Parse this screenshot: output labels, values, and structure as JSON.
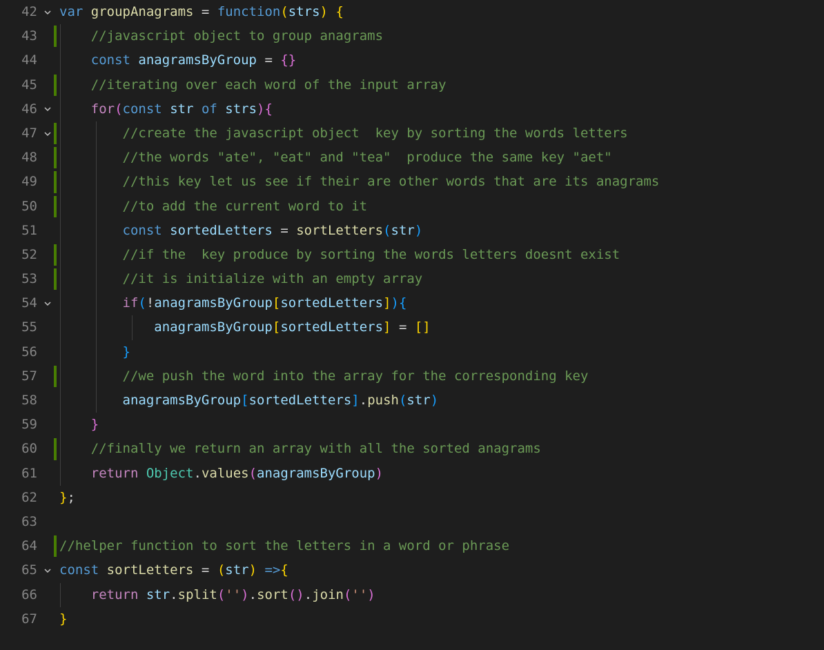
{
  "lines": [
    {
      "num": "42",
      "fold": "v",
      "mod": false,
      "guides": [],
      "tokens": [
        {
          "t": "var ",
          "c": "tok-kw"
        },
        {
          "t": "groupAnagrams",
          "c": "tok-fn"
        },
        {
          "t": " = ",
          "c": "tok-op"
        },
        {
          "t": "function",
          "c": "tok-kw"
        },
        {
          "t": "(",
          "c": "tok-br1"
        },
        {
          "t": "strs",
          "c": "tok-var"
        },
        {
          "t": ") ",
          "c": "tok-br1"
        },
        {
          "t": "{",
          "c": "tok-br1"
        }
      ]
    },
    {
      "num": "43",
      "fold": "",
      "mod": true,
      "guides": [
        0
      ],
      "tokens": [
        {
          "t": "    ",
          "c": ""
        },
        {
          "t": "//javascript object to group anagrams",
          "c": "tok-cmt"
        }
      ]
    },
    {
      "num": "44",
      "fold": "",
      "mod": false,
      "guides": [
        0
      ],
      "tokens": [
        {
          "t": "    ",
          "c": ""
        },
        {
          "t": "const ",
          "c": "tok-kw"
        },
        {
          "t": "anagramsByGroup",
          "c": "tok-var"
        },
        {
          "t": " = ",
          "c": "tok-op"
        },
        {
          "t": "{}",
          "c": "tok-br2"
        }
      ]
    },
    {
      "num": "45",
      "fold": "",
      "mod": true,
      "guides": [
        0
      ],
      "tokens": [
        {
          "t": "    ",
          "c": ""
        },
        {
          "t": "//iterating over each word of the input array",
          "c": "tok-cmt"
        }
      ]
    },
    {
      "num": "46",
      "fold": "v",
      "mod": false,
      "guides": [
        0
      ],
      "tokens": [
        {
          "t": "    ",
          "c": ""
        },
        {
          "t": "for",
          "c": "tok-kw2"
        },
        {
          "t": "(",
          "c": "tok-br2"
        },
        {
          "t": "const ",
          "c": "tok-kw"
        },
        {
          "t": "str",
          "c": "tok-var"
        },
        {
          "t": " of ",
          "c": "tok-kw"
        },
        {
          "t": "strs",
          "c": "tok-var"
        },
        {
          "t": ")",
          "c": "tok-br2"
        },
        {
          "t": "{",
          "c": "tok-br2"
        }
      ]
    },
    {
      "num": "47",
      "fold": "v",
      "mod": true,
      "guides": [
        0,
        1
      ],
      "tokens": [
        {
          "t": "        ",
          "c": ""
        },
        {
          "t": "//create the javascript object  key by sorting the words letters",
          "c": "tok-cmt"
        }
      ]
    },
    {
      "num": "48",
      "fold": "",
      "mod": true,
      "guides": [
        0,
        1
      ],
      "tokens": [
        {
          "t": "        ",
          "c": ""
        },
        {
          "t": "//the words \"ate\", \"eat\" and \"tea\"  produce the same key \"aet\"",
          "c": "tok-cmt"
        }
      ]
    },
    {
      "num": "49",
      "fold": "",
      "mod": true,
      "guides": [
        0,
        1
      ],
      "tokens": [
        {
          "t": "        ",
          "c": ""
        },
        {
          "t": "//this key let us see if their are other words that are its anagrams",
          "c": "tok-cmt"
        }
      ]
    },
    {
      "num": "50",
      "fold": "",
      "mod": true,
      "guides": [
        0,
        1
      ],
      "tokens": [
        {
          "t": "        ",
          "c": ""
        },
        {
          "t": "//to add the current word to it",
          "c": "tok-cmt"
        }
      ]
    },
    {
      "num": "51",
      "fold": "",
      "mod": false,
      "guides": [
        0,
        1
      ],
      "tokens": [
        {
          "t": "        ",
          "c": ""
        },
        {
          "t": "const ",
          "c": "tok-kw"
        },
        {
          "t": "sortedLetters",
          "c": "tok-var"
        },
        {
          "t": " = ",
          "c": "tok-op"
        },
        {
          "t": "sortLetters",
          "c": "tok-fn"
        },
        {
          "t": "(",
          "c": "tok-br3"
        },
        {
          "t": "str",
          "c": "tok-var"
        },
        {
          "t": ")",
          "c": "tok-br3"
        }
      ]
    },
    {
      "num": "52",
      "fold": "",
      "mod": true,
      "guides": [
        0,
        1
      ],
      "tokens": [
        {
          "t": "        ",
          "c": ""
        },
        {
          "t": "//if the  key produce by sorting the words letters doesnt exist",
          "c": "tok-cmt"
        }
      ]
    },
    {
      "num": "53",
      "fold": "",
      "mod": true,
      "guides": [
        0,
        1
      ],
      "tokens": [
        {
          "t": "        ",
          "c": ""
        },
        {
          "t": "//it is initialize with an empty array",
          "c": "tok-cmt"
        }
      ]
    },
    {
      "num": "54",
      "fold": "v",
      "mod": false,
      "guides": [
        0,
        1
      ],
      "tokens": [
        {
          "t": "        ",
          "c": ""
        },
        {
          "t": "if",
          "c": "tok-kw2"
        },
        {
          "t": "(",
          "c": "tok-br3"
        },
        {
          "t": "!",
          "c": "tok-op"
        },
        {
          "t": "anagramsByGroup",
          "c": "tok-var"
        },
        {
          "t": "[",
          "c": "tok-br1"
        },
        {
          "t": "sortedLetters",
          "c": "tok-var"
        },
        {
          "t": "]",
          "c": "tok-br1"
        },
        {
          "t": ")",
          "c": "tok-br3"
        },
        {
          "t": "{",
          "c": "tok-br3"
        }
      ]
    },
    {
      "num": "55",
      "fold": "",
      "mod": false,
      "guides": [
        0,
        1,
        2
      ],
      "tokens": [
        {
          "t": "            ",
          "c": ""
        },
        {
          "t": "anagramsByGroup",
          "c": "tok-var"
        },
        {
          "t": "[",
          "c": "tok-br1"
        },
        {
          "t": "sortedLetters",
          "c": "tok-var"
        },
        {
          "t": "]",
          "c": "tok-br1"
        },
        {
          "t": " = ",
          "c": "tok-op"
        },
        {
          "t": "[]",
          "c": "tok-br1"
        }
      ]
    },
    {
      "num": "56",
      "fold": "",
      "mod": false,
      "guides": [
        0,
        1
      ],
      "tokens": [
        {
          "t": "        ",
          "c": ""
        },
        {
          "t": "}",
          "c": "tok-br3"
        }
      ]
    },
    {
      "num": "57",
      "fold": "",
      "mod": true,
      "guides": [
        0,
        1
      ],
      "tokens": [
        {
          "t": "        ",
          "c": ""
        },
        {
          "t": "//we push the word into the array for the corresponding key",
          "c": "tok-cmt"
        }
      ]
    },
    {
      "num": "58",
      "fold": "",
      "mod": false,
      "guides": [
        0,
        1
      ],
      "tokens": [
        {
          "t": "        ",
          "c": ""
        },
        {
          "t": "anagramsByGroup",
          "c": "tok-var"
        },
        {
          "t": "[",
          "c": "tok-br3"
        },
        {
          "t": "sortedLetters",
          "c": "tok-var"
        },
        {
          "t": "]",
          "c": "tok-br3"
        },
        {
          "t": ".",
          "c": "tok-op"
        },
        {
          "t": "push",
          "c": "tok-fn"
        },
        {
          "t": "(",
          "c": "tok-br3"
        },
        {
          "t": "str",
          "c": "tok-var"
        },
        {
          "t": ")",
          "c": "tok-br3"
        }
      ]
    },
    {
      "num": "59",
      "fold": "",
      "mod": false,
      "guides": [
        0
      ],
      "tokens": [
        {
          "t": "    ",
          "c": ""
        },
        {
          "t": "}",
          "c": "tok-br2"
        }
      ]
    },
    {
      "num": "60",
      "fold": "",
      "mod": true,
      "guides": [
        0
      ],
      "tokens": [
        {
          "t": "    ",
          "c": ""
        },
        {
          "t": "//finally we return an array with all the sorted anagrams",
          "c": "tok-cmt"
        }
      ]
    },
    {
      "num": "61",
      "fold": "",
      "mod": false,
      "guides": [
        0
      ],
      "tokens": [
        {
          "t": "    ",
          "c": ""
        },
        {
          "t": "return ",
          "c": "tok-kw2"
        },
        {
          "t": "Object",
          "c": "tok-cls"
        },
        {
          "t": ".",
          "c": "tok-op"
        },
        {
          "t": "values",
          "c": "tok-fn"
        },
        {
          "t": "(",
          "c": "tok-br2"
        },
        {
          "t": "anagramsByGroup",
          "c": "tok-var"
        },
        {
          "t": ")",
          "c": "tok-br2"
        }
      ]
    },
    {
      "num": "62",
      "fold": "",
      "mod": false,
      "guides": [],
      "tokens": [
        {
          "t": "}",
          "c": "tok-br1"
        },
        {
          "t": ";",
          "c": "tok-pun"
        }
      ]
    },
    {
      "num": "63",
      "fold": "",
      "mod": false,
      "guides": [],
      "tokens": []
    },
    {
      "num": "64",
      "fold": "",
      "mod": true,
      "guides": [],
      "tokens": [
        {
          "t": "//helper function to sort the letters in a word or phrase",
          "c": "tok-cmt"
        }
      ]
    },
    {
      "num": "65",
      "fold": "v",
      "mod": false,
      "guides": [],
      "tokens": [
        {
          "t": "const ",
          "c": "tok-kw"
        },
        {
          "t": "sortLetters",
          "c": "tok-fn"
        },
        {
          "t": " = ",
          "c": "tok-op"
        },
        {
          "t": "(",
          "c": "tok-br1"
        },
        {
          "t": "str",
          "c": "tok-var"
        },
        {
          "t": ") ",
          "c": "tok-br1"
        },
        {
          "t": "=>",
          "c": "tok-kw"
        },
        {
          "t": "{",
          "c": "tok-br1"
        }
      ]
    },
    {
      "num": "66",
      "fold": "",
      "mod": false,
      "guides": [
        0
      ],
      "tokens": [
        {
          "t": "    ",
          "c": ""
        },
        {
          "t": "return ",
          "c": "tok-kw2"
        },
        {
          "t": "str",
          "c": "tok-var"
        },
        {
          "t": ".",
          "c": "tok-op"
        },
        {
          "t": "split",
          "c": "tok-fn"
        },
        {
          "t": "(",
          "c": "tok-br2"
        },
        {
          "t": "''",
          "c": "tok-str"
        },
        {
          "t": ")",
          "c": "tok-br2"
        },
        {
          "t": ".",
          "c": "tok-op"
        },
        {
          "t": "sort",
          "c": "tok-fn"
        },
        {
          "t": "()",
          "c": "tok-br2"
        },
        {
          "t": ".",
          "c": "tok-op"
        },
        {
          "t": "join",
          "c": "tok-fn"
        },
        {
          "t": "(",
          "c": "tok-br2"
        },
        {
          "t": "''",
          "c": "tok-str"
        },
        {
          "t": ")",
          "c": "tok-br2"
        }
      ]
    },
    {
      "num": "67",
      "fold": "",
      "mod": false,
      "guides": [],
      "tokens": [
        {
          "t": "}",
          "c": "tok-br1"
        }
      ]
    }
  ],
  "indentWidth": 52
}
